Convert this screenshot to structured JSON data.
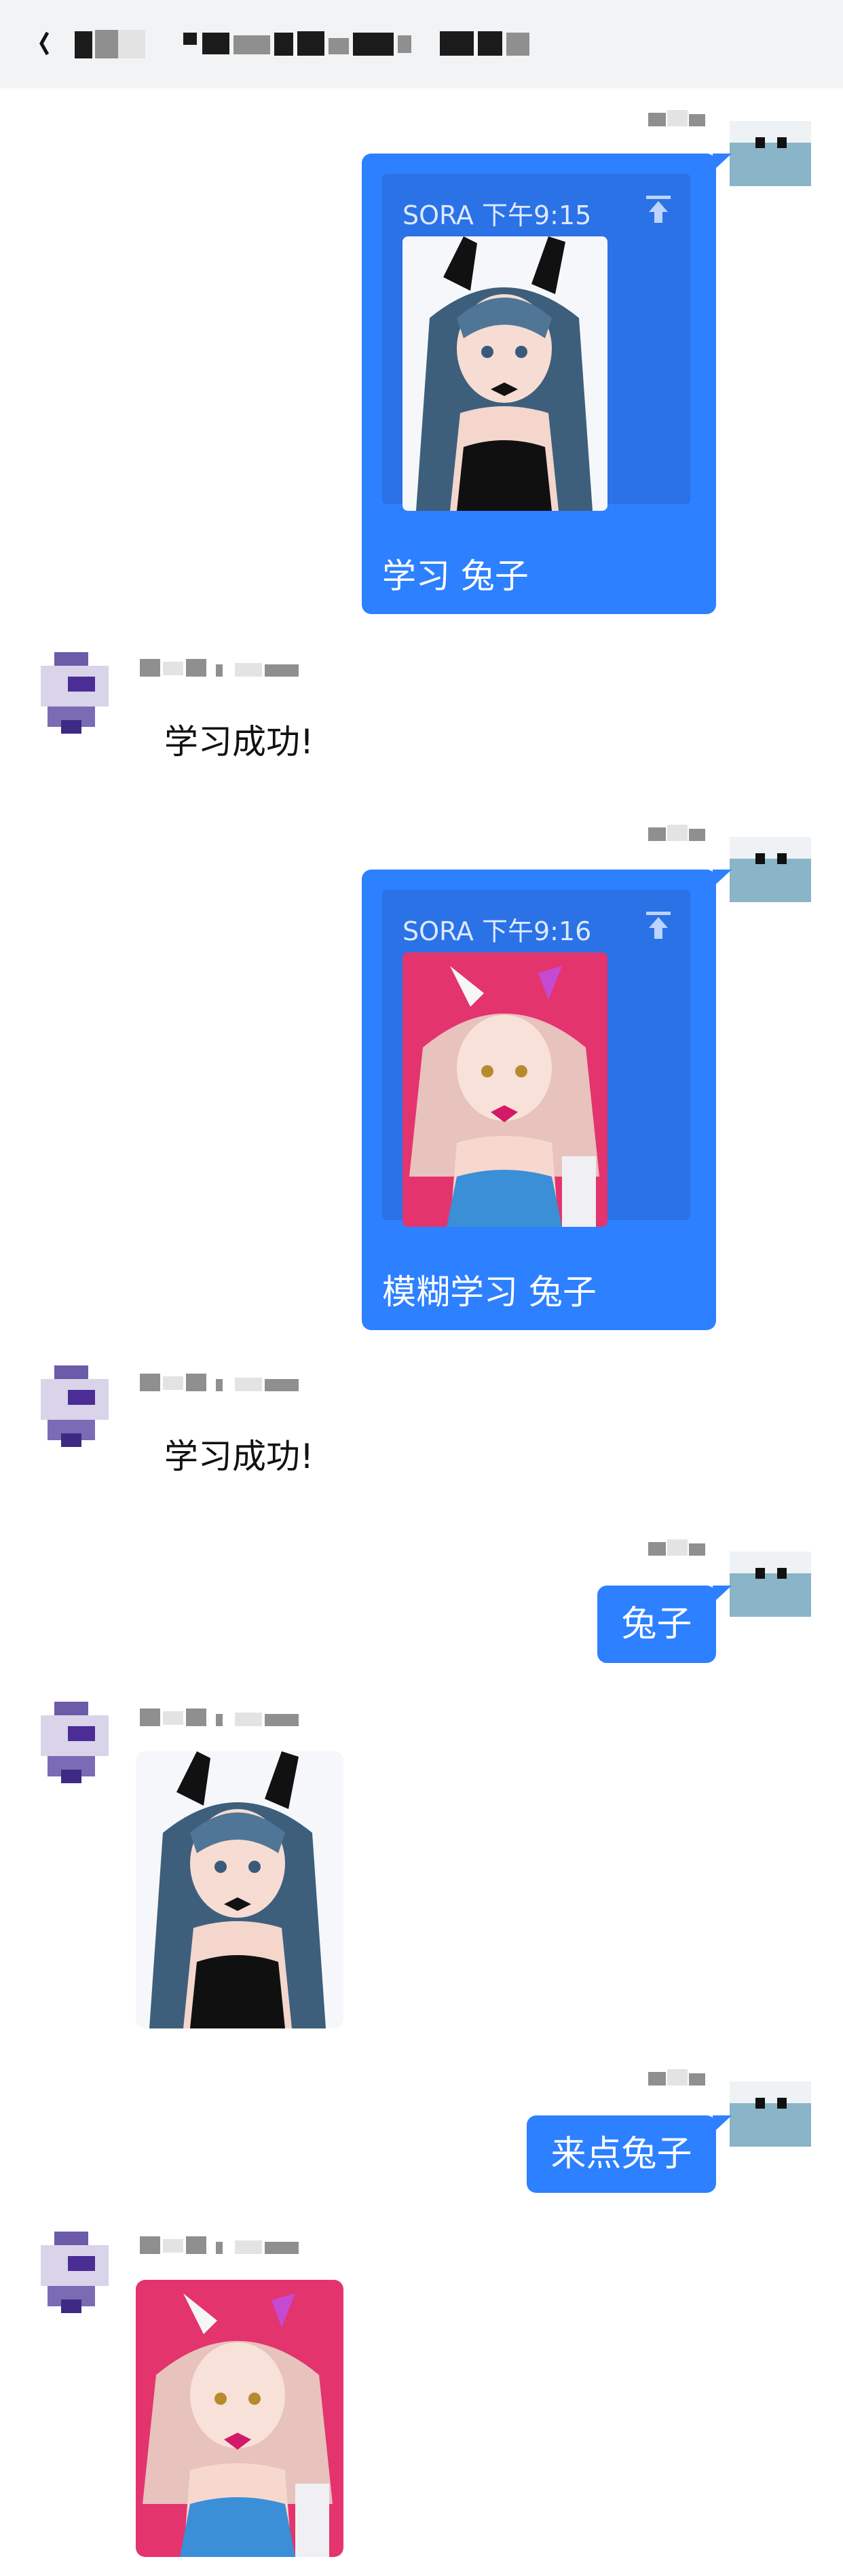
{
  "header": {
    "title": ""
  },
  "messages": [
    {
      "id": "m1",
      "side": "right",
      "type": "card",
      "meta": "SORA 下午9:15",
      "caption": "学习 兔子",
      "image_label": "blue-hair-bunny-girl"
    },
    {
      "id": "m2",
      "side": "left",
      "type": "text",
      "text": "学习成功!"
    },
    {
      "id": "m3",
      "side": "right",
      "type": "card",
      "meta": "SORA 下午9:16",
      "caption": "模糊学习 兔子",
      "image_label": "pink-hair-bunny-girl"
    },
    {
      "id": "m4",
      "side": "left",
      "type": "text",
      "text": "学习成功!"
    },
    {
      "id": "m5",
      "side": "right",
      "type": "text",
      "text": "兔子"
    },
    {
      "id": "m6",
      "side": "left",
      "type": "image",
      "image_label": "blue-hair-bunny-girl"
    },
    {
      "id": "m7",
      "side": "right",
      "type": "text",
      "text": "来点兔子"
    },
    {
      "id": "m8",
      "side": "left",
      "type": "image",
      "image_label": "pink-hair-bunny-girl"
    }
  ],
  "colors": {
    "bubble": "#2d80ff",
    "card_inner": "#2a72e6",
    "header_bg": "#f2f3f5"
  }
}
